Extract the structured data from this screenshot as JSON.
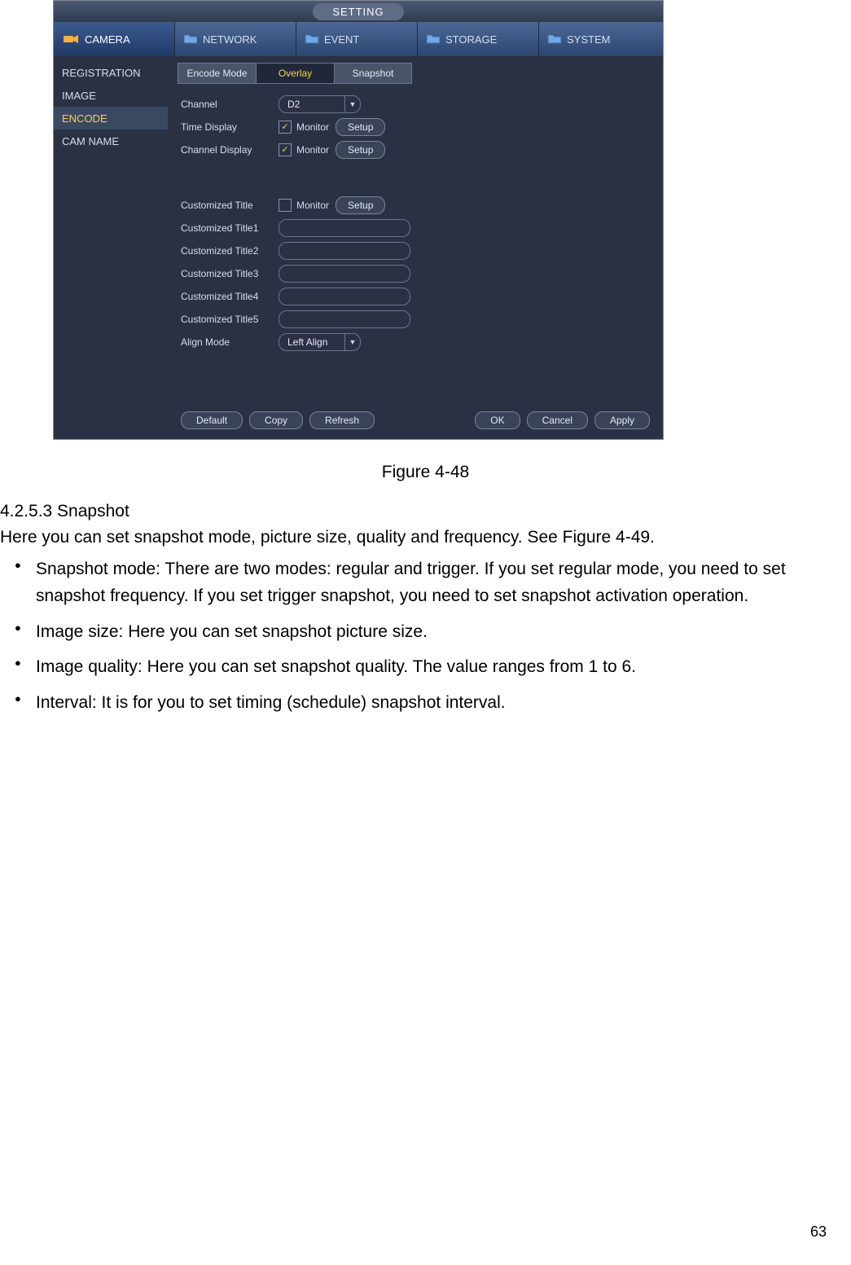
{
  "gui": {
    "title": "SETTING",
    "mainTabs": {
      "camera": "CAMERA",
      "network": "NETWORK",
      "event": "EVENT",
      "storage": "STORAGE",
      "system": "SYSTEM"
    },
    "sidebar": {
      "registration": "REGISTRATION",
      "image": "IMAGE",
      "encode": "ENCODE",
      "camname": "CAM NAME"
    },
    "subTabs": {
      "encodeMode": "Encode Mode",
      "overlay": "Overlay",
      "snapshot": "Snapshot"
    },
    "form": {
      "channelLabel": "Channel",
      "channelValue": "D2",
      "timeDisplayLabel": "Time Display",
      "channelDisplayLabel": "Channel Display",
      "monitor": "Monitor",
      "setup": "Setup",
      "custTitleLabel": "Customized Title",
      "cust1": "Customized Title1",
      "cust2": "Customized Title2",
      "cust3": "Customized Title3",
      "cust4": "Customized Title4",
      "cust5": "Customized Title5",
      "alignLabel": "Align Mode",
      "alignValue": "Left Align"
    },
    "footer": {
      "default": "Default",
      "copy": "Copy",
      "refresh": "Refresh",
      "ok": "OK",
      "cancel": "Cancel",
      "apply": "Apply"
    }
  },
  "doc": {
    "caption": "Figure 4-48",
    "secHead": "4.2.5.3  Snapshot",
    "intro": "Here you can set snapshot mode, picture size, quality and frequency. See Figure 4-49.",
    "b1": "Snapshot mode: There are two modes: regular and trigger. If you set regular mode, you need to set snapshot frequency. If you set trigger snapshot, you need to set snapshot activation operation.",
    "b2": "Image size: Here you can set snapshot picture size.",
    "b3": "Image quality: Here you can set snapshot quality. The value ranges from 1 to 6.",
    "b4": "Interval: It is for you to set timing (schedule) snapshot interval.",
    "pageNum": "63"
  }
}
